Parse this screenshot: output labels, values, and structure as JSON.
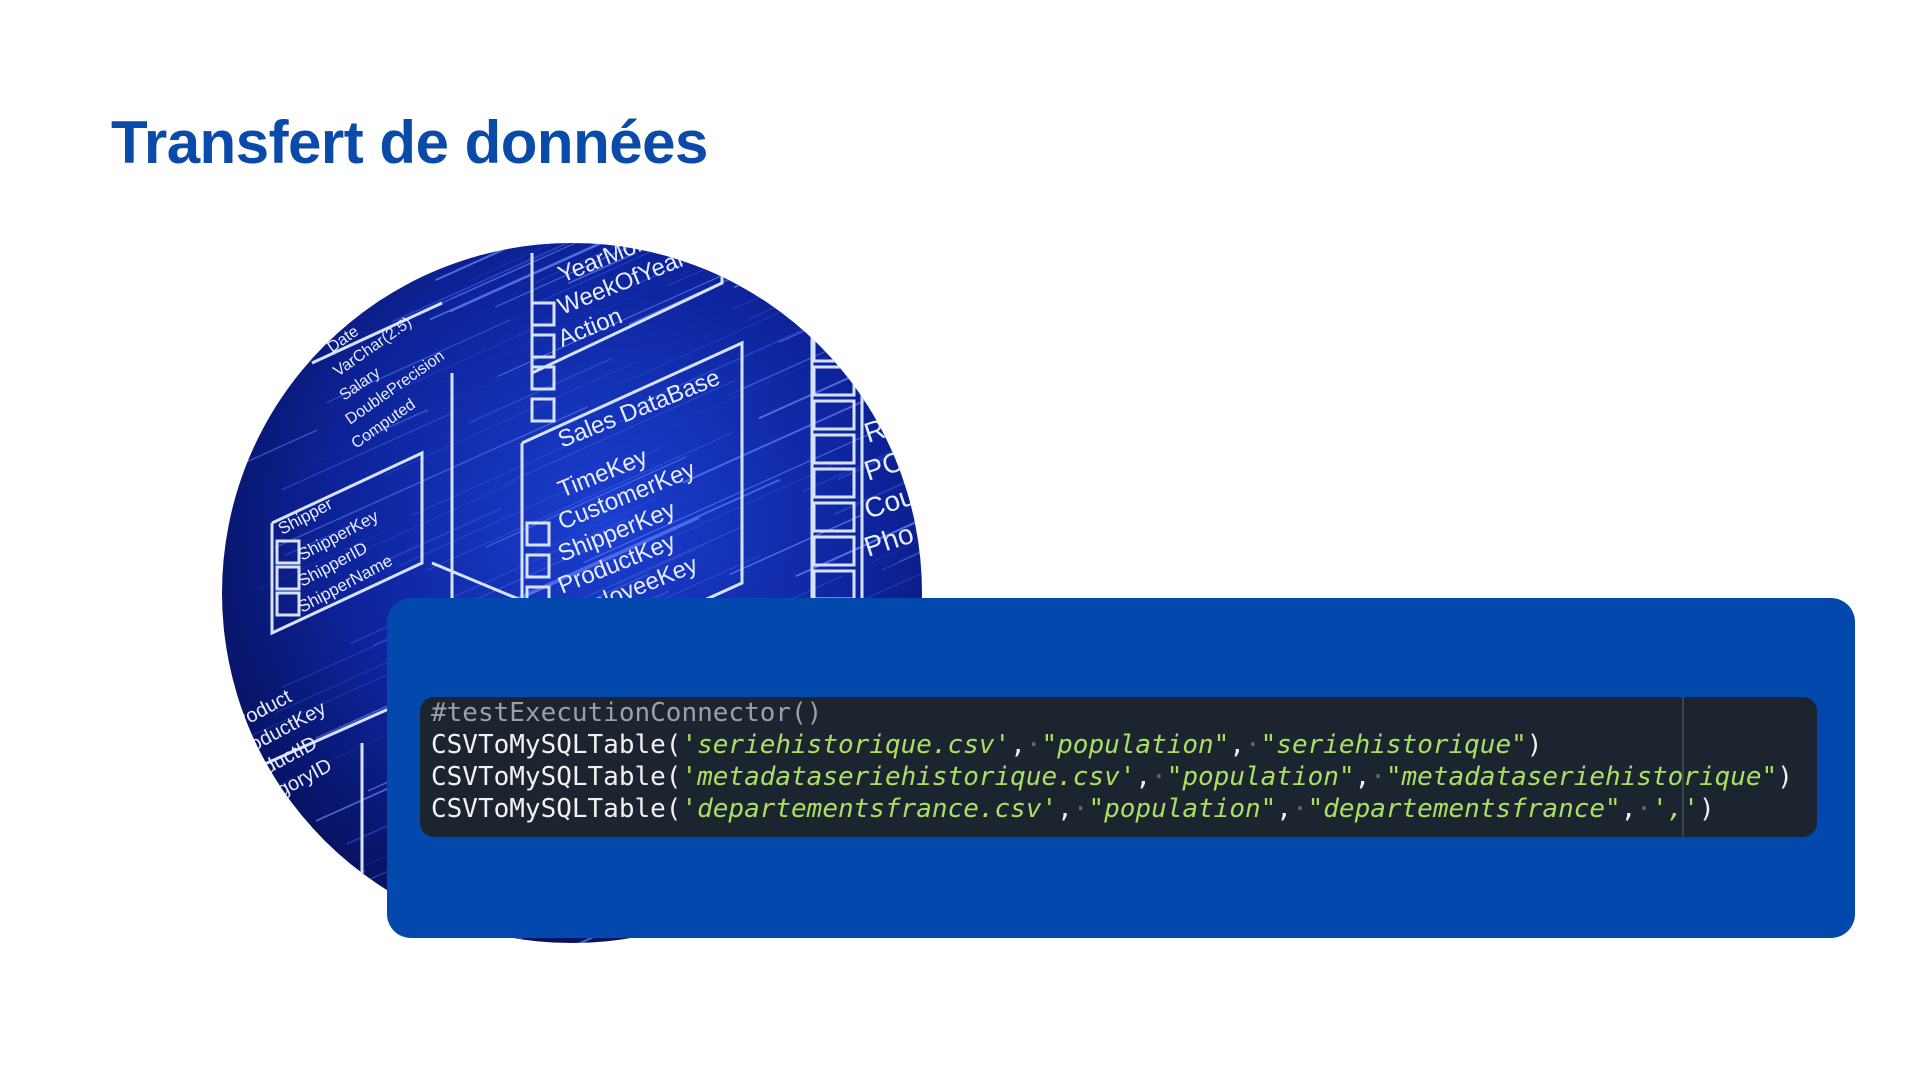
{
  "slide": {
    "title": "Transfert de données"
  },
  "image": {
    "description_labels": {
      "left_table": [
        "Date",
        "VarChar(2.5)",
        "Salary",
        "DoublePrecision",
        "Computed"
      ],
      "top_table": [
        "YearMonth",
        "WeekOfYear",
        "Action"
      ],
      "sales_table_title": "Sales DataBase",
      "sales_table_fields": [
        "TimeKey",
        "CustomerKey",
        "ShipperKey",
        "ProductKey",
        "EmployeeKey"
      ],
      "shipper_table_title": "Shipper",
      "shipper_table_fields": [
        "ShipperKey",
        "ShipperID",
        "ShipperName"
      ],
      "product_table_fields": [
        "Product",
        "ProductKey",
        "ProductID",
        "CategoryID"
      ],
      "right_table_fields": [
        "Re",
        "PC",
        "Cou",
        "Pho"
      ]
    },
    "colors": {
      "background": "#0b1a6e",
      "lines": "#c9d8ff"
    }
  },
  "code": {
    "lines": [
      [
        {
          "t": "comment",
          "v": "#testExecutionConnector()"
        }
      ],
      [
        {
          "t": "plain",
          "v": "CSVToMySQLTable("
        },
        {
          "t": "str",
          "v": "'seriehistorique.csv'"
        },
        {
          "t": "plain",
          "v": ","
        },
        {
          "t": "dot",
          "v": "·"
        },
        {
          "t": "str",
          "v": "\"population\""
        },
        {
          "t": "plain",
          "v": ","
        },
        {
          "t": "dot",
          "v": "·"
        },
        {
          "t": "str",
          "v": "\"seriehistorique\""
        },
        {
          "t": "plain",
          "v": ")"
        }
      ],
      [
        {
          "t": "plain",
          "v": "CSVToMySQLTable("
        },
        {
          "t": "str",
          "v": "'metadataseriehistorique.csv'"
        },
        {
          "t": "plain",
          "v": ","
        },
        {
          "t": "dot",
          "v": "·"
        },
        {
          "t": "str",
          "v": "\"population\""
        },
        {
          "t": "plain",
          "v": ","
        },
        {
          "t": "dot",
          "v": "·"
        },
        {
          "t": "str",
          "v": "\"metadataseriehistorique\""
        },
        {
          "t": "plain",
          "v": ")"
        }
      ],
      [
        {
          "t": "plain",
          "v": "CSVToMySQLTable("
        },
        {
          "t": "str",
          "v": "'departementsfrance.csv'"
        },
        {
          "t": "plain",
          "v": ","
        },
        {
          "t": "dot",
          "v": "·"
        },
        {
          "t": "str",
          "v": "\"population\""
        },
        {
          "t": "plain",
          "v": ","
        },
        {
          "t": "dot",
          "v": "·"
        },
        {
          "t": "str",
          "v": "\"departementsfrance\""
        },
        {
          "t": "plain",
          "v": ","
        },
        {
          "t": "dot",
          "v": "·"
        },
        {
          "t": "str",
          "v": "','"
        },
        {
          "t": "plain",
          "v": ")"
        }
      ]
    ],
    "colors": {
      "panel": "#0349ad",
      "editor": "#1c2430",
      "text": "#f1f1f1",
      "string": "#a8e05f",
      "comment": "#9aa0a6"
    }
  }
}
